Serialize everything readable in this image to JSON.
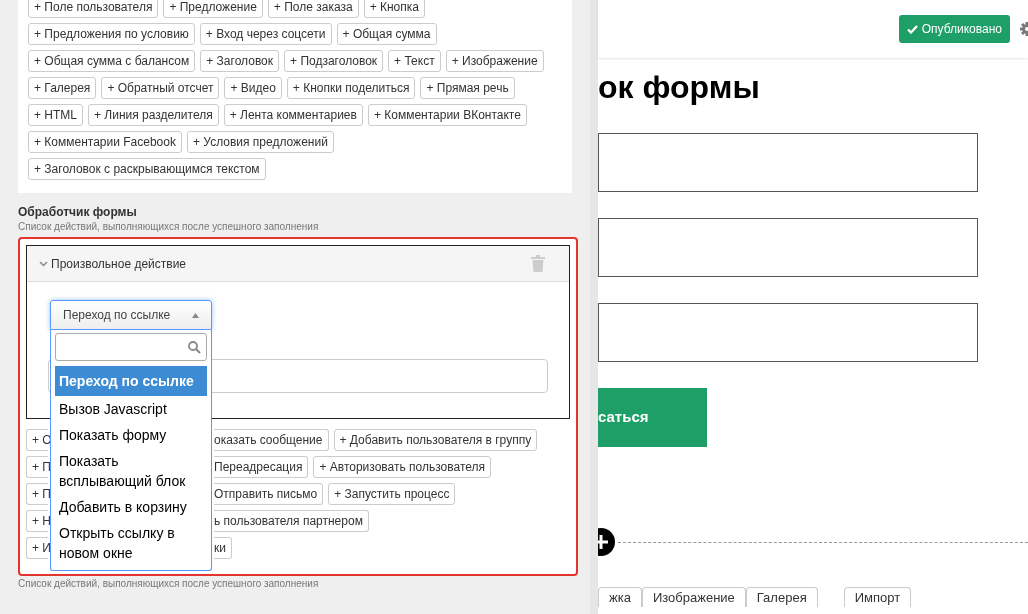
{
  "element_buttons": [
    [
      "+ Поле пользователя",
      "+ Предложение",
      "+ Поле заказа",
      "+ Кнопка"
    ],
    [
      "+ Предложения по условию",
      "+ Вход через соцсети",
      "+ Общая сумма"
    ],
    [
      "+ Общая сумма с балансом",
      "+ Заголовок",
      "+ Подзаголовок",
      "+ Текст",
      "+ Изображение"
    ],
    [
      "+ Галерея",
      "+ Обратный отсчет",
      "+ Видео",
      "+ Кнопки поделиться",
      "+ Прямая речь"
    ],
    [
      "+ HTML",
      "+ Линия разделителя",
      "+ Лента комментариев",
      "+ Комментарии ВКонтакте"
    ],
    [
      "+ Комментарии Facebook",
      "+ Условия предложений"
    ],
    [
      "+ Заголовок с раскрывающимся текстом"
    ]
  ],
  "form_handler": {
    "title": "Обработчик формы",
    "hint": "Список действий, выполняющихся после успешного заполнения",
    "action": {
      "title": "Произвольное действие",
      "expanded": true,
      "select": {
        "value": "Переход по ссылке",
        "options": [
          {
            "label": "Переход по ссылке",
            "selected": true
          },
          {
            "label": "Вызов Javascript",
            "selected": false
          },
          {
            "label": "Показать форму",
            "selected": false
          },
          {
            "label": "Показать всплывающий блок",
            "selected": false
          },
          {
            "label": "Добавить в корзину",
            "selected": false
          },
          {
            "label": "Открыть ссылку в новом окне",
            "selected": false
          }
        ]
      }
    },
    "action_buttons": [
      {
        "left": "+ О",
        "right": [
          "оказать сообщение",
          "+ Добавить пользователя в группу"
        ]
      },
      {
        "left": "+ П",
        "right": [
          "Переадресация",
          "+ Авторизовать пользователя"
        ]
      },
      {
        "left": "+ П",
        "right": [
          "Отправить письмо",
          "+ Запустить процесс"
        ]
      },
      {
        "left": "+ Н",
        "right": [
          "ь пользователя партнером"
        ]
      },
      {
        "left": "+ И",
        "right": [
          "ки"
        ]
      }
    ],
    "footer_hint": "Список действий, выполняющихся после успешного заполнения"
  },
  "topbar": {
    "publish_button": "Опубликовано"
  },
  "page": {
    "heading": "ок формы",
    "submit_button": "саться",
    "bottom_tabs": [
      "жка",
      "Изображение",
      "Галерея",
      "Импорт"
    ]
  }
}
